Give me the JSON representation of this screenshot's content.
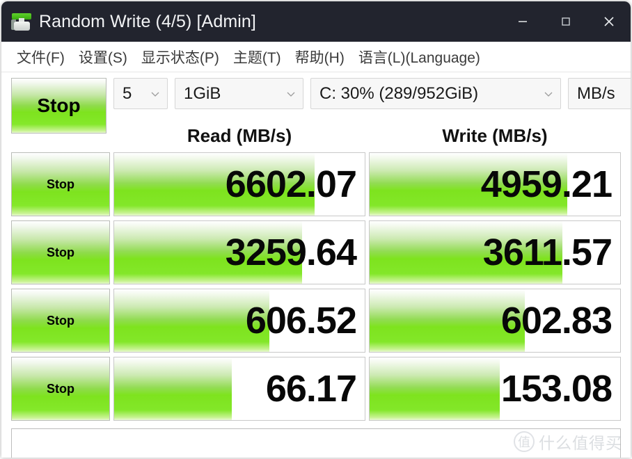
{
  "window": {
    "title": "Random Write (4/5) [Admin]",
    "icon": "crystaldiskmark-icon",
    "controls": {
      "minimize": "minimize-icon",
      "maximize": "maximize-icon",
      "close": "close-icon"
    }
  },
  "menubar": {
    "items": [
      {
        "label": "文件(F)"
      },
      {
        "label": "设置(S)"
      },
      {
        "label": "显示状态(P)"
      },
      {
        "label": "主题(T)"
      },
      {
        "label": "帮助(H)"
      },
      {
        "label": "语言(L)(Language)"
      }
    ]
  },
  "toolbar": {
    "main_button_label": "Stop",
    "count": "5",
    "size": "1GiB",
    "drive": "C: 30% (289/952GiB)",
    "unit": "MB/s"
  },
  "table": {
    "headers": {
      "read": "Read (MB/s)",
      "write": "Write (MB/s)"
    },
    "rows": [
      {
        "button_label": "Stop",
        "read_value": "6602.07",
        "read_fill_pct": 80,
        "write_value": "4959.21",
        "write_fill_pct": 79
      },
      {
        "button_label": "Stop",
        "read_value": "3259.64",
        "read_fill_pct": 75,
        "write_value": "3611.57",
        "write_fill_pct": 77
      },
      {
        "button_label": "Stop",
        "read_value": "606.52",
        "read_fill_pct": 62,
        "write_value": "602.83",
        "write_fill_pct": 62
      },
      {
        "button_label": "Stop",
        "read_value": "66.17",
        "read_fill_pct": 47,
        "write_value": "153.08",
        "write_fill_pct": 52
      }
    ]
  },
  "status_box": {
    "text": ""
  },
  "watermark": {
    "mark": "值",
    "text": "什么值得买"
  },
  "colors": {
    "titlebar_bg": "#22242e",
    "titlebar_text": "#f2f3f5",
    "accent_green": "#7ee31e",
    "accent_green_dark": "#39a90f",
    "score_text": "#080808"
  }
}
